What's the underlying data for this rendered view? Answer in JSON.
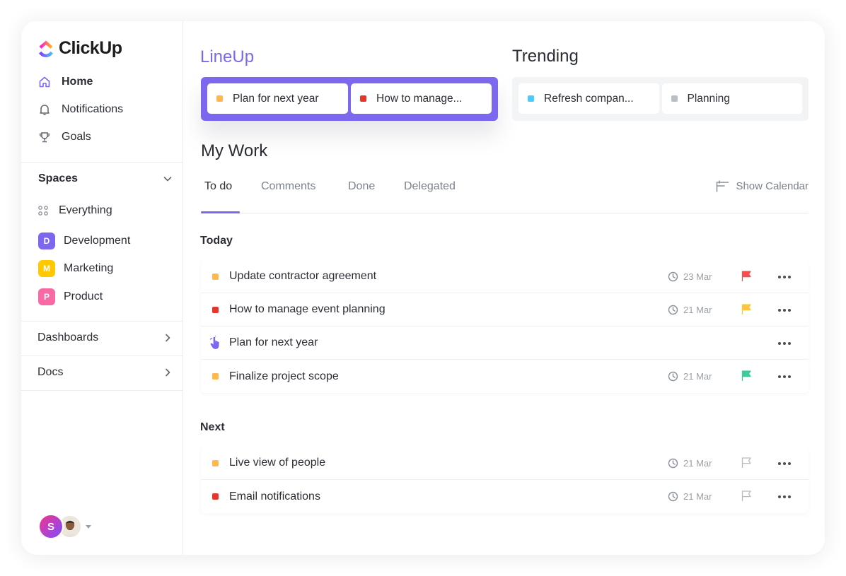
{
  "brand": {
    "name": "ClickUp"
  },
  "sidebar": {
    "nav": [
      {
        "label": "Home",
        "icon": "home-icon",
        "active": true
      },
      {
        "label": "Notifications",
        "icon": "bell-icon"
      },
      {
        "label": "Goals",
        "icon": "trophy-icon"
      }
    ],
    "spaces_label": "Spaces",
    "everything_label": "Everything",
    "spaces": [
      {
        "badge": "D",
        "label": "Development",
        "color": "#7b68ee"
      },
      {
        "badge": "M",
        "label": "Marketing",
        "color": "#ffc800"
      },
      {
        "badge": "P",
        "label": "Product",
        "color": "#f86aa4"
      }
    ],
    "dashboards_label": "Dashboards",
    "docs_label": "Docs",
    "user_avatar_initial": "S"
  },
  "lineup": {
    "title": "LineUp",
    "items": [
      {
        "label": "Plan for next year",
        "color": "#ffb84d"
      },
      {
        "label": "How to manage...",
        "color": "#e6362a"
      }
    ]
  },
  "trending": {
    "title": "Trending",
    "items": [
      {
        "label": "Refresh compan...",
        "color": "#49ccf9"
      },
      {
        "label": "Planning",
        "color": "#b9bec7"
      }
    ]
  },
  "mywork": {
    "title": "My Work",
    "tabs": [
      "To do",
      "Comments",
      "Done",
      "Delegated"
    ],
    "active_tab": "To do",
    "show_calendar_label": "Show Calendar",
    "groups": {
      "today": {
        "label": "Today",
        "tasks": [
          {
            "name": "Update contractor agreement",
            "status_color": "#ffb84d",
            "date": "23 Mar",
            "flag": "#f54e4e"
          },
          {
            "name": "How to manage event planning",
            "status_color": "#e6362a",
            "date": "21 Mar",
            "flag": "#ffc53d"
          },
          {
            "name": "Plan for next year",
            "status_icon": "drag-hand-icon",
            "date": "",
            "flag": ""
          },
          {
            "name": "Finalize project scope",
            "status_color": "#ffb84d",
            "date": "21 Mar",
            "flag": "#3ecc9f"
          }
        ]
      },
      "next": {
        "label": "Next",
        "tasks": [
          {
            "name": "Live view of people",
            "status_color": "#ffb84d",
            "date": "21 Mar",
            "flag": "outline"
          },
          {
            "name": "Email notifications",
            "status_color": "#e6362a",
            "date": "21 Mar",
            "flag": "outline"
          }
        ]
      }
    }
  }
}
